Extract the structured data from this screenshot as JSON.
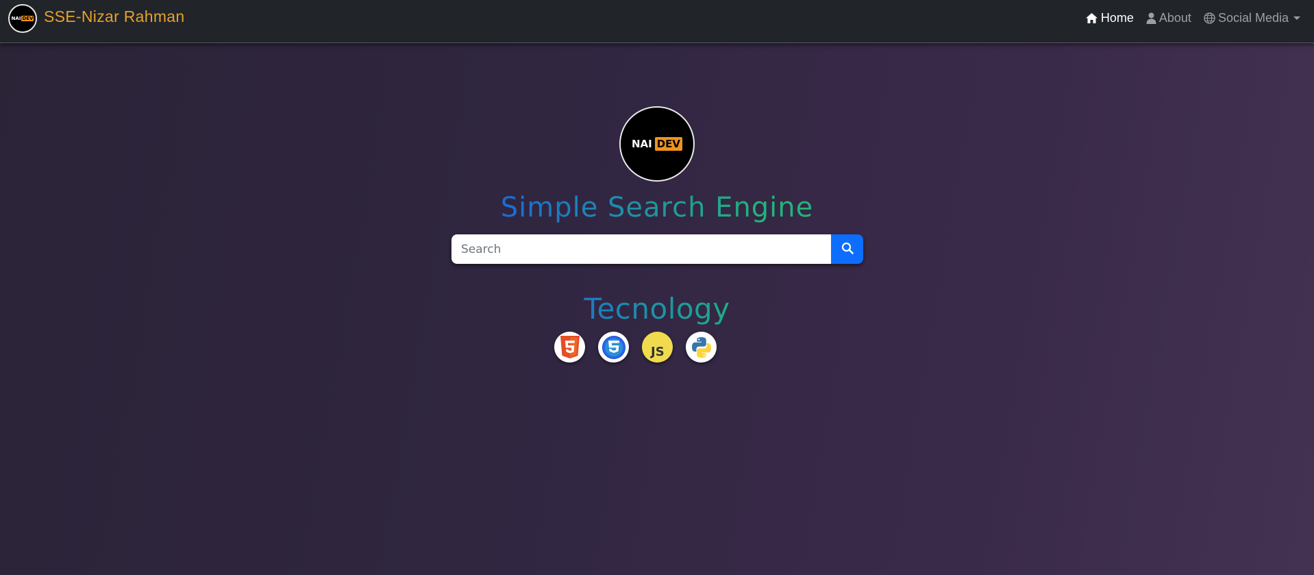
{
  "navbar": {
    "brand_name": "SSE-Nizar Rahman",
    "logo_left": "NAI",
    "logo_right": "DEV",
    "links": [
      {
        "label": "Home",
        "icon": "home-icon",
        "active": true
      },
      {
        "label": "About",
        "icon": "user-icon",
        "active": false
      },
      {
        "label": "Social Media",
        "icon": "globe-icon",
        "active": false,
        "dropdown": true
      }
    ]
  },
  "hero": {
    "logo_left": "NAI",
    "logo_right": "DEV",
    "title": "Simple Search Engine"
  },
  "search": {
    "placeholder": "Search",
    "value": "",
    "button_icon": "search-icon"
  },
  "tech": {
    "title": "Tecnology",
    "icons": [
      "html5-icon",
      "css3-icon",
      "js-icon",
      "python-icon"
    ],
    "js_text": "JS"
  },
  "colors": {
    "brand": "#e5a12b",
    "accent": "#0d6efd",
    "navbar_bg": "#212429",
    "logo_orange": "#f0931c"
  }
}
